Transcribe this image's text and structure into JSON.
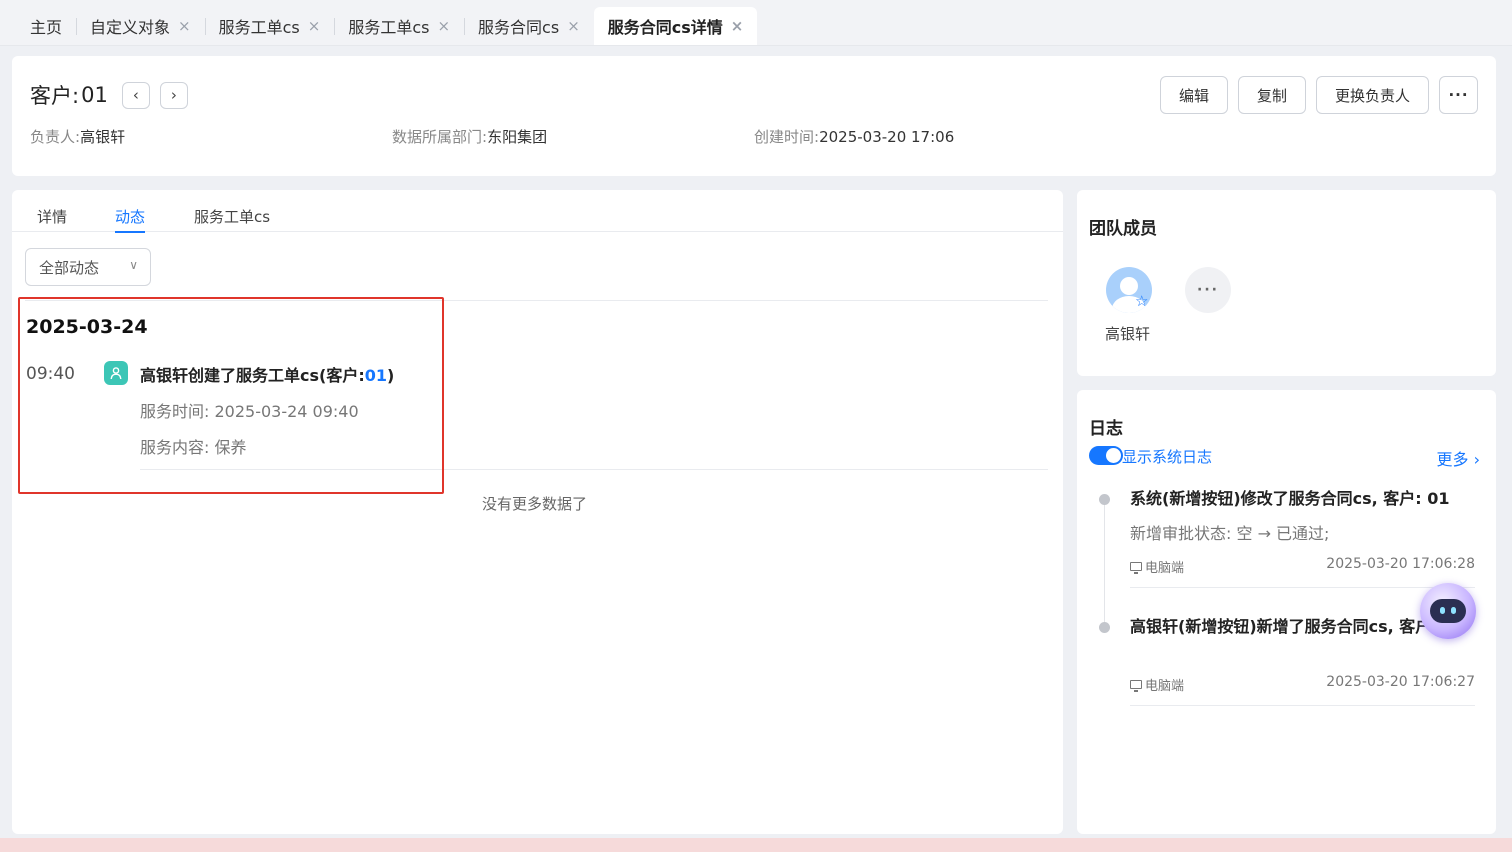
{
  "tabs": [
    {
      "label": "主页",
      "closable": false
    },
    {
      "label": "自定义对象",
      "closable": true
    },
    {
      "label": "服务工单cs",
      "closable": true
    },
    {
      "label": "服务工单cs",
      "closable": true
    },
    {
      "label": "服务合同cs",
      "closable": true
    },
    {
      "label": "服务合同cs详情",
      "closable": true,
      "active": true
    }
  ],
  "close_glyph": "×",
  "header": {
    "title_label": "客户:",
    "title_value": "01",
    "prev_glyph": "‹",
    "next_glyph": "›",
    "owner_label": "负责人:",
    "owner_value": "高银轩",
    "dept_label": "数据所属部门:",
    "dept_value": "东阳集团",
    "created_label": "创建时间:",
    "created_value": "2025-03-20 17:06",
    "actions": {
      "edit": "编辑",
      "copy": "复制",
      "change_owner": "更换负责人",
      "more": "···"
    }
  },
  "subtabs": {
    "details": "详情",
    "activity": "动态",
    "service_orders": "服务工单cs"
  },
  "filter": {
    "selected": "全部动态",
    "chevron": "∨"
  },
  "feed": {
    "date": "2025-03-24",
    "event": {
      "time": "09:40",
      "icon": "user-icon",
      "title_prefix": "高银轩创建了服务工单cs(客户:",
      "title_link": "01",
      "title_suffix": ")",
      "service_time": "服务时间: 2025-03-24 09:40",
      "service_content": "服务内容: 保养"
    },
    "no_more": "没有更多数据了"
  },
  "team": {
    "title": "团队成员",
    "members": [
      {
        "name": "高银轩",
        "role_icon": "star-icon"
      }
    ],
    "more": "···"
  },
  "log": {
    "title": "日志",
    "show_system_label": "显示系统日志",
    "show_system_on": true,
    "more_label": "更多 ›",
    "entries": [
      {
        "title": "系统(新增按钮)修改了服务合同cs, 客户: 01",
        "detail": "新增审批状态: 空 → 已通过;",
        "source": "电脑端",
        "time": "2025-03-20 17:06:28"
      },
      {
        "title": "高银轩(新增按钮)新增了服务合同cs, 客户: 01",
        "source": "电脑端",
        "time": "2025-03-20 17:06:27"
      }
    ]
  },
  "colors": {
    "accent": "#1677ff",
    "highlight": "#e0352b",
    "event_icon": "#3cc6b6"
  }
}
